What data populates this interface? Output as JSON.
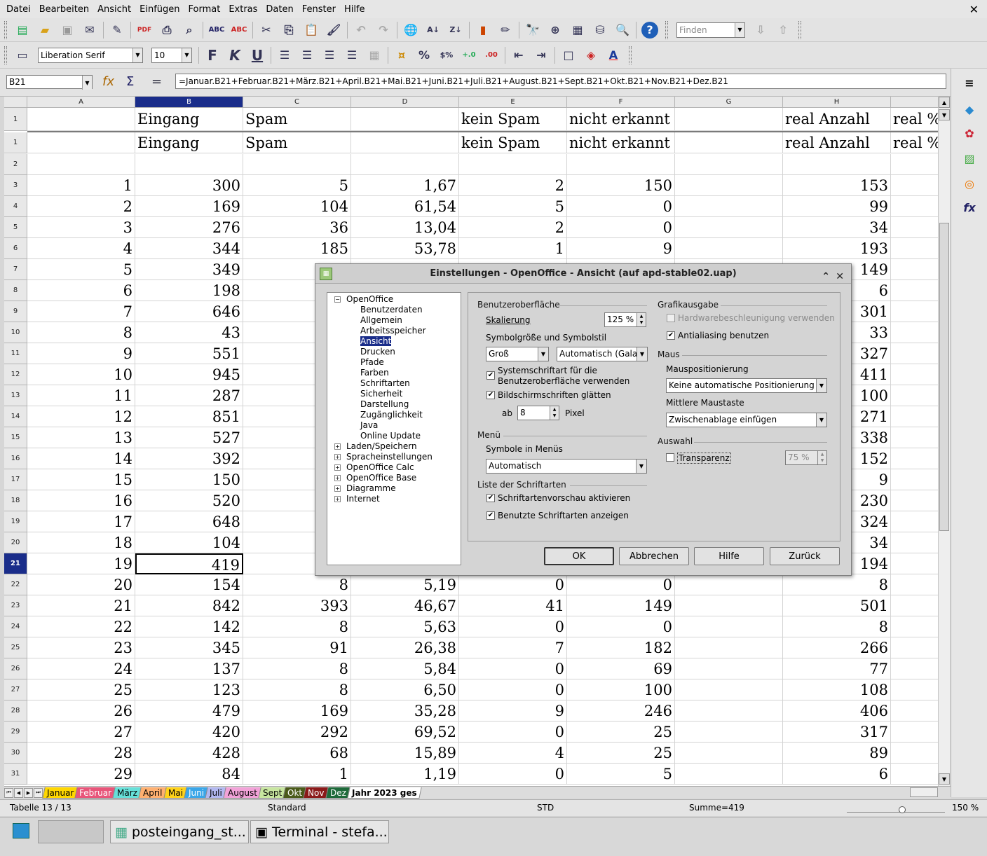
{
  "menu": [
    "Datei",
    "Bearbeiten",
    "Ansicht",
    "Einfügen",
    "Format",
    "Extras",
    "Daten",
    "Fenster",
    "Hilfe"
  ],
  "toolbar": {
    "find_placeholder": "Finden",
    "font_name": "Liberation Serif",
    "font_size": "10"
  },
  "formula": {
    "cell_ref": "B21",
    "content": "=Januar.B21+Februar.B21+März.B21+April.B21+Mai.B21+Juni.B21+Juli.B21+August.B21+Sept.B21+Okt.B21+Nov.B21+Dez.B21"
  },
  "grid": {
    "columns": [
      "A",
      "B",
      "C",
      "D",
      "E",
      "F",
      "G",
      "H",
      ""
    ],
    "header_row": {
      "row": "1",
      "cells": [
        "",
        "Eingang",
        "Spam",
        "",
        "kein Spam",
        "nicht erkannt",
        "",
        "real Anzahl",
        "real %"
      ]
    },
    "rows": [
      {
        "row": "1",
        "cells": [
          "",
          "Eingang",
          "Spam",
          "",
          "kein Spam",
          "nicht erkannt",
          "",
          "real Anzahl",
          "real %"
        ]
      },
      {
        "row": "2",
        "cells": [
          "",
          "",
          "",
          "",
          "",
          "",
          "",
          "",
          ""
        ]
      },
      {
        "row": "3",
        "cells": [
          "1",
          "300",
          "5",
          "1,67",
          "2",
          "150",
          "",
          "153",
          ""
        ]
      },
      {
        "row": "4",
        "cells": [
          "2",
          "169",
          "104",
          "61,54",
          "5",
          "0",
          "",
          "99",
          ""
        ]
      },
      {
        "row": "5",
        "cells": [
          "3",
          "276",
          "36",
          "13,04",
          "2",
          "0",
          "",
          "34",
          ""
        ]
      },
      {
        "row": "6",
        "cells": [
          "4",
          "344",
          "185",
          "53,78",
          "1",
          "9",
          "",
          "193",
          ""
        ]
      },
      {
        "row": "7",
        "cells": [
          "5",
          "349",
          "",
          "",
          "",
          "",
          "",
          "149",
          ""
        ]
      },
      {
        "row": "8",
        "cells": [
          "6",
          "198",
          "",
          "",
          "",
          "",
          "",
          "6",
          ""
        ]
      },
      {
        "row": "9",
        "cells": [
          "7",
          "646",
          "",
          "",
          "",
          "",
          "",
          "301",
          ""
        ]
      },
      {
        "row": "10",
        "cells": [
          "8",
          "43",
          "",
          "",
          "",
          "",
          "",
          "33",
          ""
        ]
      },
      {
        "row": "11",
        "cells": [
          "9",
          "551",
          "",
          "",
          "",
          "",
          "",
          "327",
          ""
        ]
      },
      {
        "row": "12",
        "cells": [
          "10",
          "945",
          "",
          "",
          "",
          "",
          "",
          "411",
          ""
        ]
      },
      {
        "row": "13",
        "cells": [
          "11",
          "287",
          "",
          "",
          "",
          "",
          "",
          "100",
          ""
        ]
      },
      {
        "row": "14",
        "cells": [
          "12",
          "851",
          "",
          "",
          "",
          "",
          "",
          "271",
          ""
        ]
      },
      {
        "row": "15",
        "cells": [
          "13",
          "527",
          "",
          "",
          "",
          "",
          "",
          "338",
          ""
        ]
      },
      {
        "row": "16",
        "cells": [
          "14",
          "392",
          "",
          "",
          "",
          "",
          "",
          "152",
          ""
        ]
      },
      {
        "row": "17",
        "cells": [
          "15",
          "150",
          "",
          "",
          "",
          "",
          "",
          "9",
          ""
        ]
      },
      {
        "row": "18",
        "cells": [
          "16",
          "520",
          "",
          "",
          "",
          "",
          "",
          "230",
          ""
        ]
      },
      {
        "row": "19",
        "cells": [
          "17",
          "648",
          "",
          "",
          "",
          "",
          "",
          "324",
          ""
        ]
      },
      {
        "row": "20",
        "cells": [
          "18",
          "104",
          "",
          "",
          "",
          "",
          "",
          "34",
          ""
        ]
      },
      {
        "row": "21",
        "cells": [
          "19",
          "419",
          "",
          "",
          "",
          "",
          "",
          "194",
          ""
        ]
      },
      {
        "row": "22",
        "cells": [
          "20",
          "154",
          "8",
          "5,19",
          "0",
          "0",
          "",
          "8",
          ""
        ]
      },
      {
        "row": "23",
        "cells": [
          "21",
          "842",
          "393",
          "46,67",
          "41",
          "149",
          "",
          "501",
          ""
        ]
      },
      {
        "row": "24",
        "cells": [
          "22",
          "142",
          "8",
          "5,63",
          "0",
          "0",
          "",
          "8",
          ""
        ]
      },
      {
        "row": "25",
        "cells": [
          "23",
          "345",
          "91",
          "26,38",
          "7",
          "182",
          "",
          "266",
          ""
        ]
      },
      {
        "row": "26",
        "cells": [
          "24",
          "137",
          "8",
          "5,84",
          "0",
          "69",
          "",
          "77",
          ""
        ]
      },
      {
        "row": "27",
        "cells": [
          "25",
          "123",
          "8",
          "6,50",
          "0",
          "100",
          "",
          "108",
          ""
        ]
      },
      {
        "row": "28",
        "cells": [
          "26",
          "479",
          "169",
          "35,28",
          "9",
          "246",
          "",
          "406",
          ""
        ]
      },
      {
        "row": "29",
        "cells": [
          "27",
          "420",
          "292",
          "69,52",
          "0",
          "25",
          "",
          "317",
          ""
        ]
      },
      {
        "row": "30",
        "cells": [
          "28",
          "428",
          "68",
          "15,89",
          "4",
          "25",
          "",
          "89",
          ""
        ]
      },
      {
        "row": "31",
        "cells": [
          "29",
          "84",
          "1",
          "1,19",
          "0",
          "5",
          "",
          "6",
          ""
        ]
      }
    ]
  },
  "sheet_tabs": [
    {
      "label": "Januar",
      "color": "#ffd700"
    },
    {
      "label": "Februar",
      "color": "#e8557a"
    },
    {
      "label": "März",
      "color": "#66e0d9"
    },
    {
      "label": "April",
      "color": "#ffb070"
    },
    {
      "label": "Mai",
      "color": "#ffd21a"
    },
    {
      "label": "Juni",
      "color": "#3aa6e8"
    },
    {
      "label": "Juli",
      "color": "#b2b8f0"
    },
    {
      "label": "August",
      "color": "#f2a2d8"
    },
    {
      "label": "Sept",
      "color": "#c8e6a0"
    },
    {
      "label": "Okt",
      "color": "#4a5a1a"
    },
    {
      "label": "Nov",
      "color": "#8b1a1a"
    },
    {
      "label": "Dez",
      "color": "#1e6a3a"
    },
    {
      "label": "Jahr 2023 ges",
      "color": "#ffffff"
    }
  ],
  "status": {
    "sheet": "Tabelle 13 / 13",
    "style": "Standard",
    "mode": "STD",
    "sum": "Summe=419",
    "zoom": "150 %"
  },
  "taskbar": {
    "item1": "posteingang_st...",
    "item2": "Terminal - stefa..."
  },
  "dialog": {
    "title": "Einstellungen - OpenOffice - Ansicht (auf apd-stable02.uap)",
    "tree": {
      "root": "OpenOffice",
      "children": [
        "Benutzerdaten",
        "Allgemein",
        "Arbeitsspeicher",
        "Ansicht",
        "Drucken",
        "Pfade",
        "Farben",
        "Schriftarten",
        "Sicherheit",
        "Darstellung",
        "Zugänglichkeit",
        "Java",
        "Online Update"
      ],
      "selected": "Ansicht",
      "others": [
        "Laden/Speichern",
        "Spracheinstellungen",
        "OpenOffice Calc",
        "OpenOffice Base",
        "Diagramme",
        "Internet"
      ]
    },
    "ui_group": "Benutzeroberfläche",
    "scaling_label": "Skalierung",
    "scaling_value": "125 %",
    "icon_label": "Symbolgröße und Symbolstil",
    "icon_size": "Groß",
    "icon_style": "Automatisch (Galaxy)",
    "system_font_label_1": "Systemschriftart für die",
    "system_font_label_2": "Benutzeroberfläche verwenden",
    "smooth_label": "Bildschirmschriften glätten",
    "from_label": "ab",
    "from_value": "8",
    "pixel_label": "Pixel",
    "menu_group": "Menü",
    "menu_icons_label": "Symbole in Menüs",
    "menu_icons_value": "Automatisch",
    "fontlist_group": "Liste der Schriftarten",
    "font_preview_label": "Schriftartenvorschau aktivieren",
    "used_fonts_label": "Benutzte Schriftarten anzeigen",
    "graphics_group": "Grafikausgabe",
    "hw_accel_label": "Hardwarebeschleunigung verwenden",
    "antialias_label": "Antialiasing benutzen",
    "mouse_group": "Maus",
    "mouse_pos_label": "Mauspositionierung",
    "mouse_pos_value": "Keine automatische Positionierung",
    "middle_label": "Mittlere Maustaste",
    "middle_value": "Zwischenablage einfügen",
    "selection_group": "Auswahl",
    "transparency_label": "Transparenz",
    "transparency_value": "75 %",
    "buttons": {
      "ok": "OK",
      "cancel": "Abbrechen",
      "help": "Hilfe",
      "back": "Zurück"
    }
  }
}
